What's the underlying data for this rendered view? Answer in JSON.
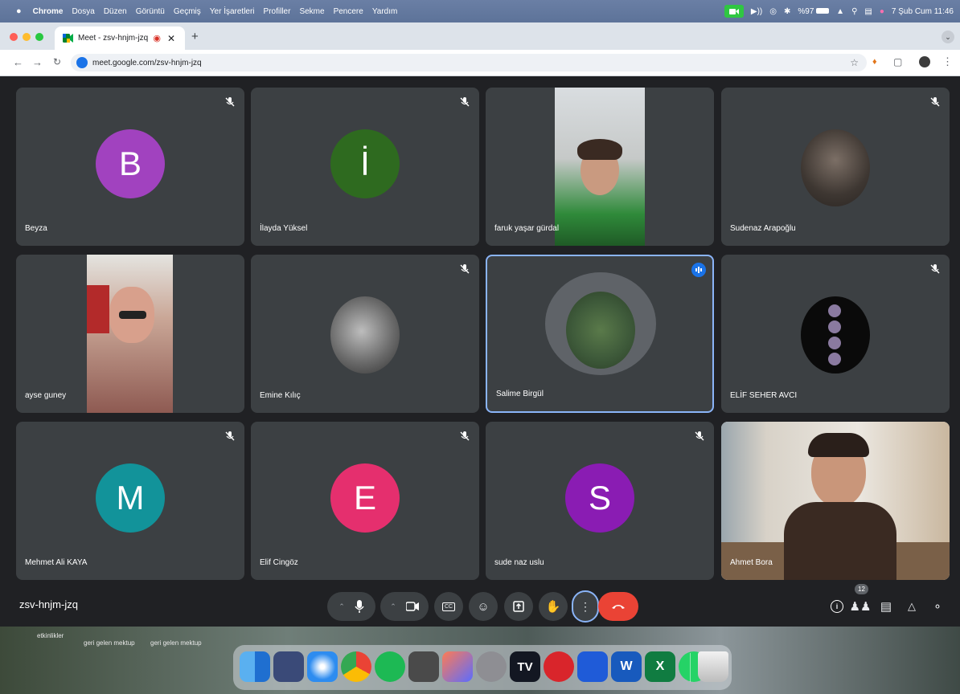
{
  "menubar": {
    "app_name": "Chrome",
    "menus": [
      "Dosya",
      "Düzen",
      "Görüntü",
      "Geçmiş",
      "Yer İşaretleri",
      "Profiller",
      "Sekme",
      "Pencere",
      "Yardım"
    ],
    "battery": "%97",
    "datetime": "7 Şub Cum  11:46"
  },
  "browser": {
    "tab_title": "Meet - zsv-hnjm-jzq",
    "url": "meet.google.com/zsv-hnjm-jzq"
  },
  "meet": {
    "meeting_code": "zsv-hnjm-jzq",
    "participant_count": "12",
    "participants": [
      {
        "name": "Beyza",
        "initial": "B",
        "color": "#a142bf",
        "muted": true
      },
      {
        "name": "İlayda Yüksel",
        "initial": "İ",
        "color": "#2e6a1f",
        "muted": true
      },
      {
        "name": "faruk yaşar gürdal",
        "muted": false,
        "video": true
      },
      {
        "name": "Sudenaz Arapoğlu",
        "muted": true,
        "photo": true
      },
      {
        "name": "ayse guney",
        "muted": false,
        "video": true
      },
      {
        "name": "Emine Kılıç",
        "muted": true,
        "photo": true
      },
      {
        "name": "Salime Birgül",
        "muted": false,
        "speaking": true,
        "photo": true
      },
      {
        "name": "ELİF SEHER AVCI",
        "muted": true,
        "photo": true
      },
      {
        "name": "Mehmet Ali KAYA",
        "initial": "M",
        "color": "#12939a",
        "muted": true
      },
      {
        "name": "Elif Cingöz",
        "initial": "E",
        "color": "#e52f6e",
        "muted": true
      },
      {
        "name": "sude naz uslu",
        "initial": "S",
        "color": "#8a1cb3",
        "muted": true
      },
      {
        "name": "Ahmet Bora",
        "muted": false,
        "video": true
      }
    ]
  },
  "desktop": {
    "labels": [
      "etkinlikler",
      "geri gelen mektup",
      "geri gelen mektup"
    ]
  }
}
